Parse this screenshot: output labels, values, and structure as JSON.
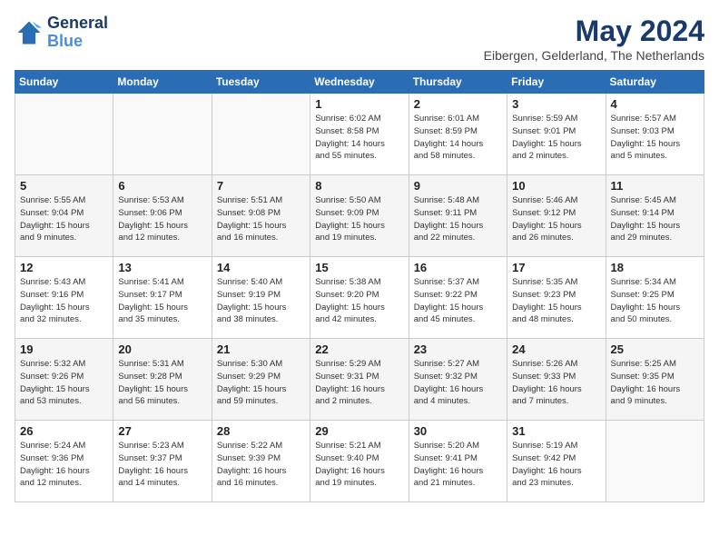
{
  "logo": {
    "line1": "General",
    "line2": "Blue"
  },
  "title": "May 2024",
  "subtitle": "Eibergen, Gelderland, The Netherlands",
  "headers": [
    "Sunday",
    "Monday",
    "Tuesday",
    "Wednesday",
    "Thursday",
    "Friday",
    "Saturday"
  ],
  "weeks": [
    [
      {
        "day": "",
        "info": ""
      },
      {
        "day": "",
        "info": ""
      },
      {
        "day": "",
        "info": ""
      },
      {
        "day": "1",
        "info": "Sunrise: 6:02 AM\nSunset: 8:58 PM\nDaylight: 14 hours\nand 55 minutes."
      },
      {
        "day": "2",
        "info": "Sunrise: 6:01 AM\nSunset: 8:59 PM\nDaylight: 14 hours\nand 58 minutes."
      },
      {
        "day": "3",
        "info": "Sunrise: 5:59 AM\nSunset: 9:01 PM\nDaylight: 15 hours\nand 2 minutes."
      },
      {
        "day": "4",
        "info": "Sunrise: 5:57 AM\nSunset: 9:03 PM\nDaylight: 15 hours\nand 5 minutes."
      }
    ],
    [
      {
        "day": "5",
        "info": "Sunrise: 5:55 AM\nSunset: 9:04 PM\nDaylight: 15 hours\nand 9 minutes."
      },
      {
        "day": "6",
        "info": "Sunrise: 5:53 AM\nSunset: 9:06 PM\nDaylight: 15 hours\nand 12 minutes."
      },
      {
        "day": "7",
        "info": "Sunrise: 5:51 AM\nSunset: 9:08 PM\nDaylight: 15 hours\nand 16 minutes."
      },
      {
        "day": "8",
        "info": "Sunrise: 5:50 AM\nSunset: 9:09 PM\nDaylight: 15 hours\nand 19 minutes."
      },
      {
        "day": "9",
        "info": "Sunrise: 5:48 AM\nSunset: 9:11 PM\nDaylight: 15 hours\nand 22 minutes."
      },
      {
        "day": "10",
        "info": "Sunrise: 5:46 AM\nSunset: 9:12 PM\nDaylight: 15 hours\nand 26 minutes."
      },
      {
        "day": "11",
        "info": "Sunrise: 5:45 AM\nSunset: 9:14 PM\nDaylight: 15 hours\nand 29 minutes."
      }
    ],
    [
      {
        "day": "12",
        "info": "Sunrise: 5:43 AM\nSunset: 9:16 PM\nDaylight: 15 hours\nand 32 minutes."
      },
      {
        "day": "13",
        "info": "Sunrise: 5:41 AM\nSunset: 9:17 PM\nDaylight: 15 hours\nand 35 minutes."
      },
      {
        "day": "14",
        "info": "Sunrise: 5:40 AM\nSunset: 9:19 PM\nDaylight: 15 hours\nand 38 minutes."
      },
      {
        "day": "15",
        "info": "Sunrise: 5:38 AM\nSunset: 9:20 PM\nDaylight: 15 hours\nand 42 minutes."
      },
      {
        "day": "16",
        "info": "Sunrise: 5:37 AM\nSunset: 9:22 PM\nDaylight: 15 hours\nand 45 minutes."
      },
      {
        "day": "17",
        "info": "Sunrise: 5:35 AM\nSunset: 9:23 PM\nDaylight: 15 hours\nand 48 minutes."
      },
      {
        "day": "18",
        "info": "Sunrise: 5:34 AM\nSunset: 9:25 PM\nDaylight: 15 hours\nand 50 minutes."
      }
    ],
    [
      {
        "day": "19",
        "info": "Sunrise: 5:32 AM\nSunset: 9:26 PM\nDaylight: 15 hours\nand 53 minutes."
      },
      {
        "day": "20",
        "info": "Sunrise: 5:31 AM\nSunset: 9:28 PM\nDaylight: 15 hours\nand 56 minutes."
      },
      {
        "day": "21",
        "info": "Sunrise: 5:30 AM\nSunset: 9:29 PM\nDaylight: 15 hours\nand 59 minutes."
      },
      {
        "day": "22",
        "info": "Sunrise: 5:29 AM\nSunset: 9:31 PM\nDaylight: 16 hours\nand 2 minutes."
      },
      {
        "day": "23",
        "info": "Sunrise: 5:27 AM\nSunset: 9:32 PM\nDaylight: 16 hours\nand 4 minutes."
      },
      {
        "day": "24",
        "info": "Sunrise: 5:26 AM\nSunset: 9:33 PM\nDaylight: 16 hours\nand 7 minutes."
      },
      {
        "day": "25",
        "info": "Sunrise: 5:25 AM\nSunset: 9:35 PM\nDaylight: 16 hours\nand 9 minutes."
      }
    ],
    [
      {
        "day": "26",
        "info": "Sunrise: 5:24 AM\nSunset: 9:36 PM\nDaylight: 16 hours\nand 12 minutes."
      },
      {
        "day": "27",
        "info": "Sunrise: 5:23 AM\nSunset: 9:37 PM\nDaylight: 16 hours\nand 14 minutes."
      },
      {
        "day": "28",
        "info": "Sunrise: 5:22 AM\nSunset: 9:39 PM\nDaylight: 16 hours\nand 16 minutes."
      },
      {
        "day": "29",
        "info": "Sunrise: 5:21 AM\nSunset: 9:40 PM\nDaylight: 16 hours\nand 19 minutes."
      },
      {
        "day": "30",
        "info": "Sunrise: 5:20 AM\nSunset: 9:41 PM\nDaylight: 16 hours\nand 21 minutes."
      },
      {
        "day": "31",
        "info": "Sunrise: 5:19 AM\nSunset: 9:42 PM\nDaylight: 16 hours\nand 23 minutes."
      },
      {
        "day": "",
        "info": ""
      }
    ]
  ]
}
